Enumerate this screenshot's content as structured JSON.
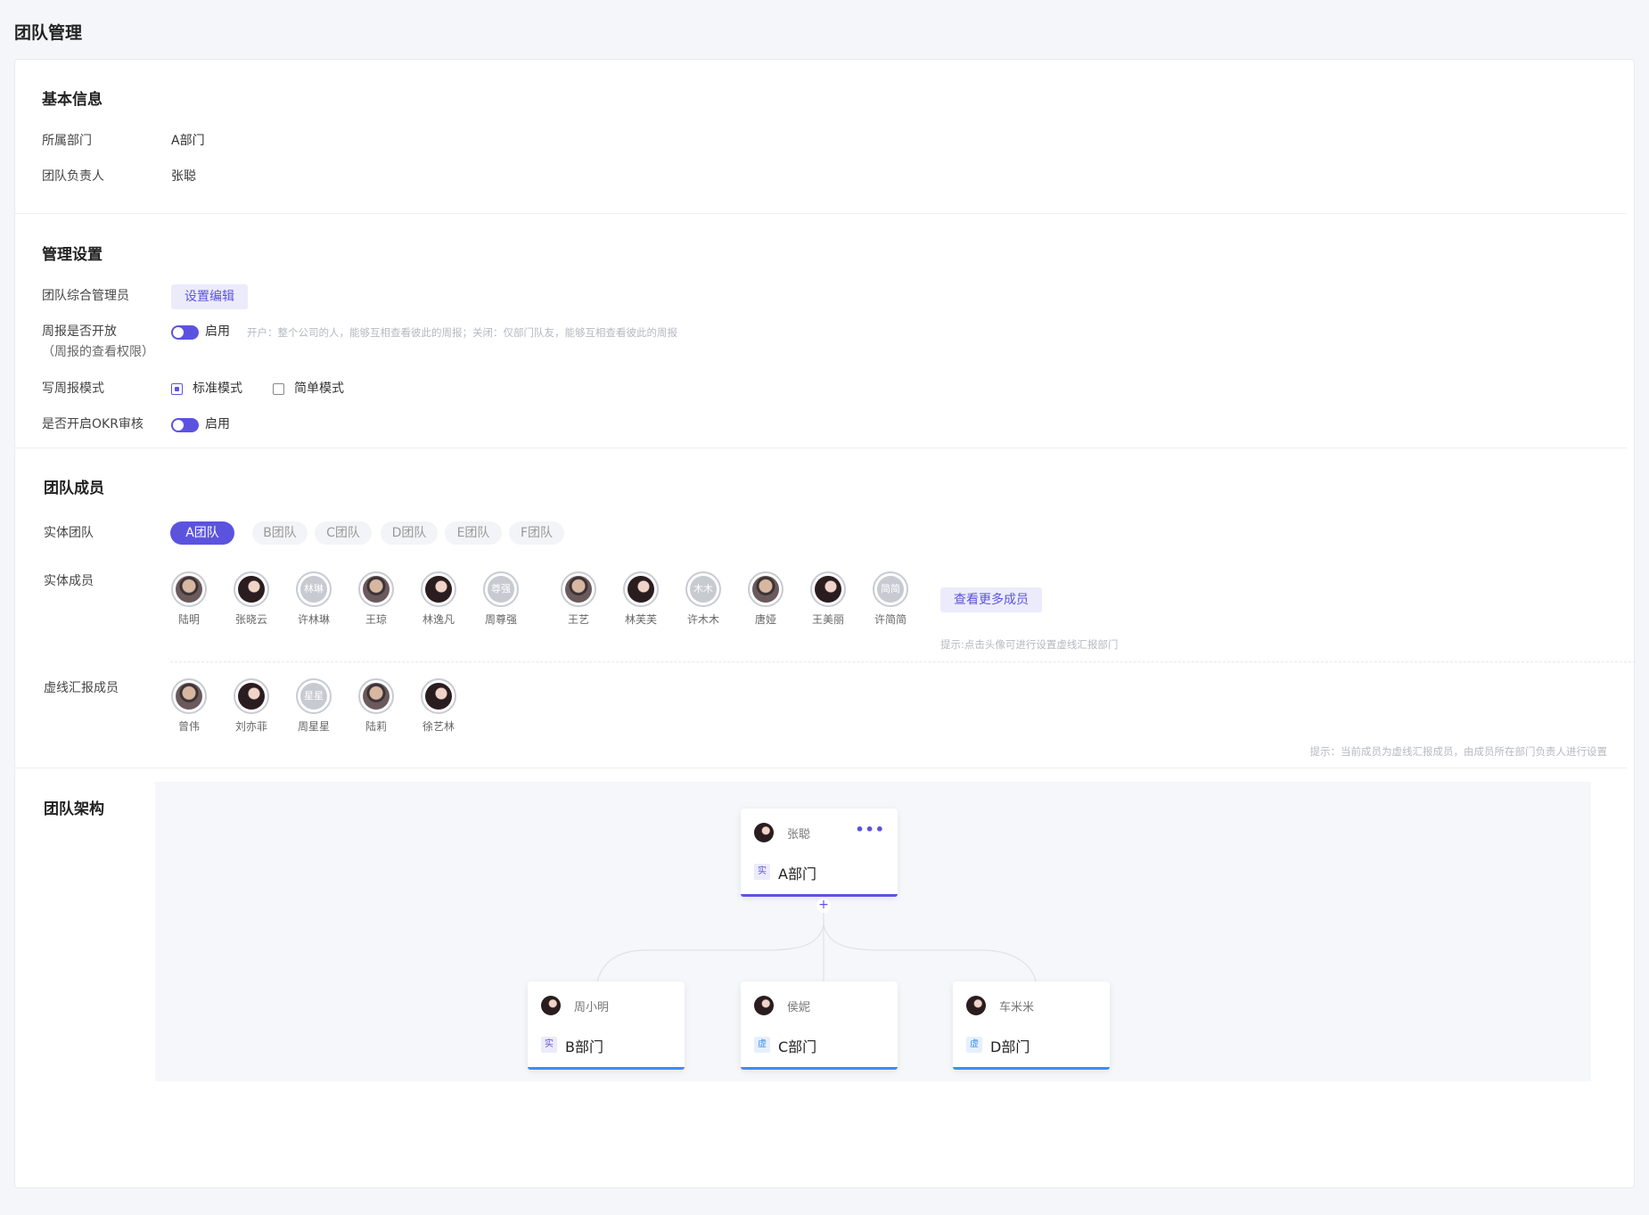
{
  "page": {
    "title": "团队管理"
  },
  "basic": {
    "title": "基本信息",
    "dept_label": "所属部门",
    "dept_value": "A部门",
    "leader_label": "团队负责人",
    "leader_value": "张聪"
  },
  "manage": {
    "title": "管理设置",
    "admin_label": "团队综合管理员",
    "admin_button": "设置编辑",
    "weekly_label": "周报是否开放",
    "weekly_sublabel": "（周报的查看权限）",
    "weekly_toggle_text": "启用",
    "weekly_toggle_on": true,
    "weekly_hint": "开户：整个公司的人，能够互相查看彼此的周报；关闭：仅部门队友，能够互相查看彼此的周报",
    "mode_label": "写周报模式",
    "mode_options": [
      "标准模式",
      "简单模式"
    ],
    "mode_selected": "标准模式",
    "okr_label": "是否开启OKR审核",
    "okr_toggle_text": "启用",
    "okr_toggle_on": true
  },
  "members": {
    "title": "团队成员",
    "entity_team_label": "实体团队",
    "teams": [
      "A团队",
      "B团队",
      "C团队",
      "D团队",
      "E团队",
      "F团队"
    ],
    "active_team": "A团队",
    "entity_members_label": "实体成员",
    "entity_members": [
      {
        "name": "陆明",
        "avatar": "man"
      },
      {
        "name": "张晓云",
        "avatar": "woman"
      },
      {
        "name": "许林琳",
        "avatar": "text",
        "initials": "林琳"
      },
      {
        "name": "王琼",
        "avatar": "man"
      },
      {
        "name": "林逸凡",
        "avatar": "woman"
      },
      {
        "name": "周尊强",
        "avatar": "text",
        "initials": "尊强"
      },
      {
        "name": "王艺",
        "avatar": "man"
      },
      {
        "name": "林芙芙",
        "avatar": "woman"
      },
      {
        "name": "许木木",
        "avatar": "text",
        "initials": "木木"
      },
      {
        "name": "唐娅",
        "avatar": "man"
      },
      {
        "name": "王美丽",
        "avatar": "woman"
      },
      {
        "name": "许简简",
        "avatar": "text",
        "initials": "简简"
      }
    ],
    "more_button": "查看更多成员",
    "entity_hint": "提示:点击头像可进行设置虚线汇报部门",
    "virtual_label": "虚线汇报成员",
    "virtual_members": [
      {
        "name": "曾伟",
        "avatar": "man"
      },
      {
        "name": "刘亦菲",
        "avatar": "woman"
      },
      {
        "name": "周星星",
        "avatar": "text",
        "initials": "星星"
      },
      {
        "name": "陆莉",
        "avatar": "man"
      },
      {
        "name": "徐艺林",
        "avatar": "woman"
      }
    ],
    "virtual_hint": "提示：当前成员为虚线汇报成员，由成员所在部门负责人进行设置"
  },
  "structure": {
    "title": "团队架构",
    "root": {
      "person": "张聪",
      "tag": "实",
      "dept": "A部门",
      "more": "•••"
    },
    "children": [
      {
        "person": "周小明",
        "tag": "实",
        "dept": "B部门"
      },
      {
        "person": "侯妮",
        "tag": "虚",
        "dept": "C部门"
      },
      {
        "person": "车米米",
        "tag": "虚",
        "dept": "D部门"
      }
    ],
    "expand_symbol": "+",
    "colors": {
      "root_bar": "#5b53e0",
      "child_bar": "#3d8ef0",
      "real_tag_bg": "#ecebfb",
      "real_tag_fg": "#5b53e0",
      "virtual_tag_bg": "#e6f0fd",
      "virtual_tag_fg": "#3d8ef0"
    }
  }
}
